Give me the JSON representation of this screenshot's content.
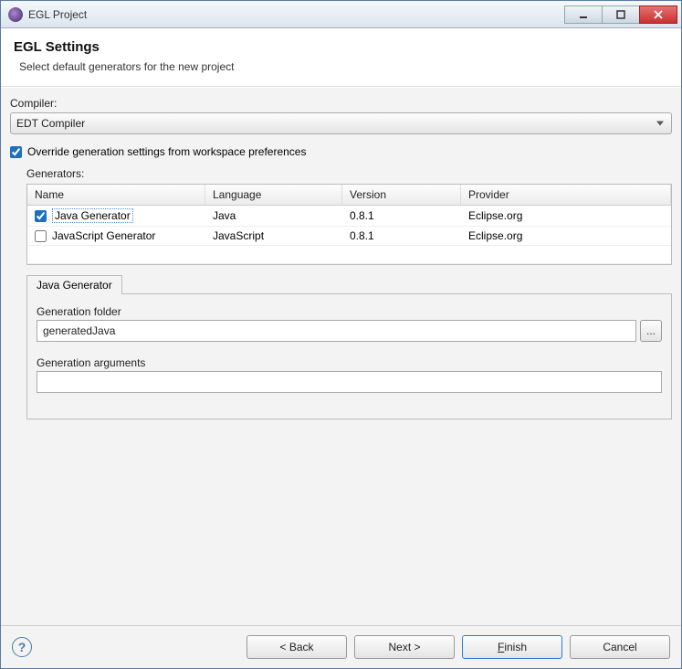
{
  "window": {
    "title": "EGL Project"
  },
  "header": {
    "title": "EGL Settings",
    "subtitle": "Select default generators for the new project"
  },
  "compiler": {
    "label": "Compiler:",
    "selected": "EDT Compiler"
  },
  "override": {
    "checked": true,
    "label": "Override generation settings from workspace preferences"
  },
  "generators": {
    "label": "Generators:",
    "columns": {
      "name": "Name",
      "language": "Language",
      "version": "Version",
      "provider": "Provider"
    },
    "rows": [
      {
        "checked": true,
        "selected": true,
        "name": "Java Generator",
        "language": "Java",
        "version": "0.8.1",
        "provider": "Eclipse.org"
      },
      {
        "checked": false,
        "selected": false,
        "name": "JavaScript Generator",
        "language": "JavaScript",
        "version": "0.8.1",
        "provider": "Eclipse.org"
      }
    ]
  },
  "tab": {
    "title": "Java Generator",
    "folder": {
      "label": "Generation folder",
      "value": "generatedJava",
      "browse": "..."
    },
    "args": {
      "label": "Generation arguments",
      "value": ""
    }
  },
  "footer": {
    "back": "< Back",
    "next": "Next >",
    "finish": "Finish",
    "cancel": "Cancel"
  }
}
